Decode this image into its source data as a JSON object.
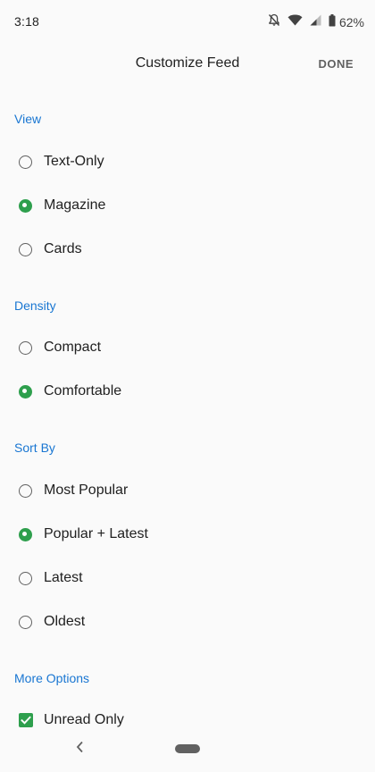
{
  "status_bar": {
    "time": "3:18",
    "battery_percent": "62%",
    "icons": [
      "notifications-off-icon",
      "wifi-icon",
      "cell-signal-icon",
      "battery-icon"
    ]
  },
  "app_bar": {
    "title": "Customize Feed",
    "done_label": "DONE"
  },
  "sections": {
    "view": {
      "header": "View",
      "options": [
        {
          "label": "Text-Only",
          "checked": false
        },
        {
          "label": "Magazine",
          "checked": true
        },
        {
          "label": "Cards",
          "checked": false
        }
      ]
    },
    "density": {
      "header": "Density",
      "options": [
        {
          "label": "Compact",
          "checked": false
        },
        {
          "label": "Comfortable",
          "checked": true
        }
      ]
    },
    "sort_by": {
      "header": "Sort By",
      "options": [
        {
          "label": "Most Popular",
          "checked": false
        },
        {
          "label": "Popular + Latest",
          "checked": true
        },
        {
          "label": "Latest",
          "checked": false
        },
        {
          "label": "Oldest",
          "checked": false
        }
      ]
    },
    "more_options": {
      "header": "More Options",
      "options": [
        {
          "label": "Unread Only",
          "checked": true
        }
      ]
    }
  },
  "navigation": {
    "icons": [
      "back-icon",
      "home-pill-icon"
    ]
  },
  "colors": {
    "accent_blue": "#1976d2",
    "selected_green": "#2e9f4d",
    "background": "#fafafa"
  }
}
